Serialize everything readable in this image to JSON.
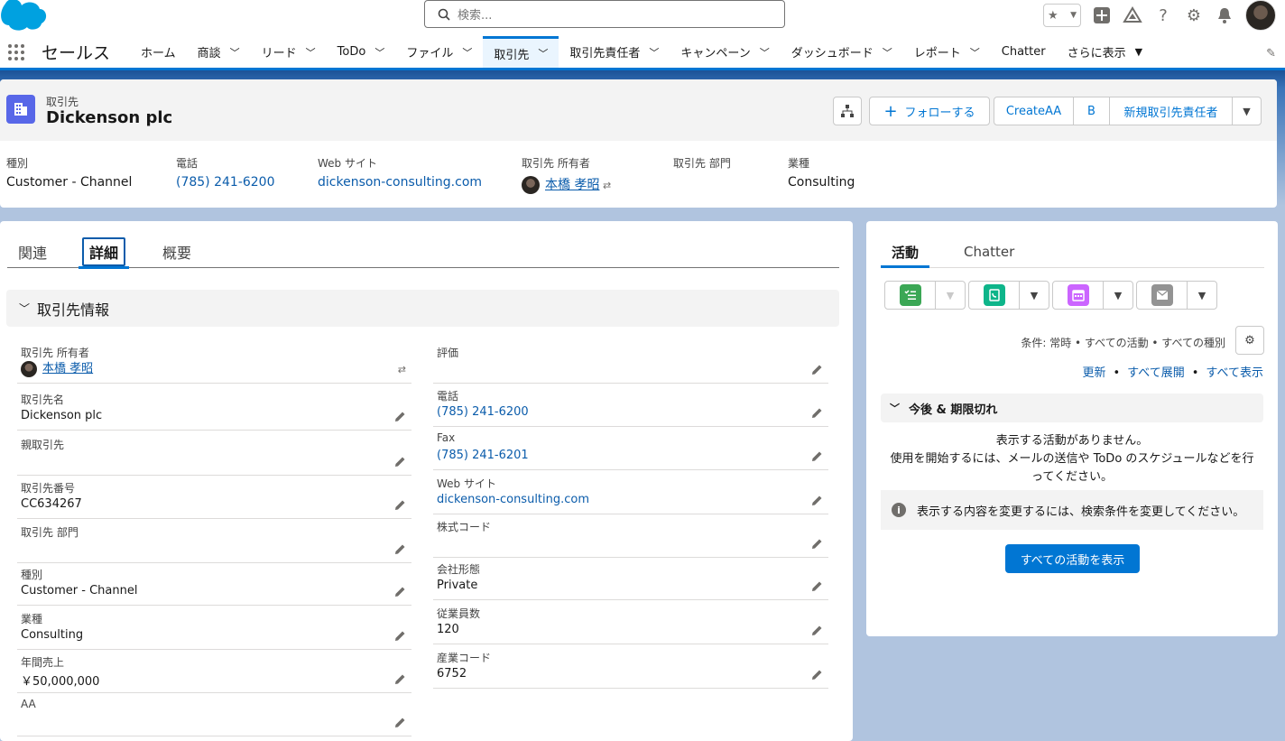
{
  "search": {
    "placeholder": "検索..."
  },
  "app": {
    "name": "セールス"
  },
  "nav": [
    {
      "label": "ホーム",
      "chevron": false
    },
    {
      "label": "商談",
      "chevron": true
    },
    {
      "label": "リード",
      "chevron": true
    },
    {
      "label": "ToDo",
      "chevron": true
    },
    {
      "label": "ファイル",
      "chevron": true
    },
    {
      "label": "取引先",
      "chevron": true,
      "active": true
    },
    {
      "label": "取引先責任者",
      "chevron": true
    },
    {
      "label": "キャンペーン",
      "chevron": true
    },
    {
      "label": "ダッシュボード",
      "chevron": true
    },
    {
      "label": "レポート",
      "chevron": true
    },
    {
      "label": "Chatter",
      "chevron": false
    },
    {
      "label": "さらに表示",
      "chevron": true
    }
  ],
  "record": {
    "object_label": "取引先",
    "name": "Dickenson plc",
    "follow_label": "フォローする",
    "btn_createaa": "CreateAA",
    "btn_b": "B",
    "btn_new_contact": "新規取引先責任者"
  },
  "highlights": [
    {
      "label": "種別",
      "value": "Customer - Channel",
      "kind": "text"
    },
    {
      "label": "電話",
      "value": "(785) 241-6200",
      "kind": "link"
    },
    {
      "label": "Web サイト",
      "value": "dickenson-consulting.com",
      "kind": "link"
    },
    {
      "label": "取引先 所有者",
      "value": "本橋 孝昭",
      "kind": "user"
    },
    {
      "label": "取引先 部門",
      "value": "",
      "kind": "text"
    },
    {
      "label": "業種",
      "value": "Consulting",
      "kind": "text"
    }
  ],
  "tabs": {
    "related": "関連",
    "details": "詳細",
    "overview": "概要"
  },
  "section_title": "取引先情報",
  "left_fields": [
    {
      "label": "取引先 所有者",
      "value": "本橋 孝昭",
      "kind": "user"
    },
    {
      "label": "取引先名",
      "value": "Dickenson plc",
      "kind": "text"
    },
    {
      "label": "親取引先",
      "value": "",
      "kind": "text"
    },
    {
      "label": "取引先番号",
      "value": "CC634267",
      "kind": "text"
    },
    {
      "label": "取引先 部門",
      "value": "",
      "kind": "text"
    },
    {
      "label": "種別",
      "value": "Customer - Channel",
      "kind": "text"
    },
    {
      "label": "業種",
      "value": "Consulting",
      "kind": "text"
    },
    {
      "label": "年間売上",
      "value": "￥50,000,000",
      "kind": "text"
    },
    {
      "label": "AA",
      "value": "",
      "kind": "text"
    }
  ],
  "right_fields": [
    {
      "label": "評価",
      "value": "",
      "kind": "text"
    },
    {
      "label": "電話",
      "value": "(785) 241-6200",
      "kind": "link"
    },
    {
      "label": "Fax",
      "value": "(785) 241-6201",
      "kind": "link"
    },
    {
      "label": "Web サイト",
      "value": "dickenson-consulting.com",
      "kind": "link"
    },
    {
      "label": "株式コード",
      "value": "",
      "kind": "text"
    },
    {
      "label": "会社形態",
      "value": "Private",
      "kind": "text"
    },
    {
      "label": "従業員数",
      "value": "120",
      "kind": "text"
    },
    {
      "label": "産業コード",
      "value": "6752",
      "kind": "text"
    }
  ],
  "activity": {
    "tab_activity": "活動",
    "tab_chatter": "Chatter",
    "filter_text": "条件: 常時 • すべての活動 • すべての種別",
    "refresh": "更新",
    "expand_all": "すべて展開",
    "view_all": "すべて表示",
    "upcoming_title": "今後 & 期限切れ",
    "empty_line1": "表示する活動がありません。",
    "empty_line2": "使用を開始するには、メールの送信や ToDo のスケジュールなどを行ってください。",
    "info_text": "表示する内容を変更するには、検索条件を変更してください。",
    "show_all_button": "すべての活動を表示",
    "colors": {
      "task": "#3ba755",
      "call": "#0eb58a",
      "event": "#cb65ff",
      "email": "#939393"
    }
  }
}
